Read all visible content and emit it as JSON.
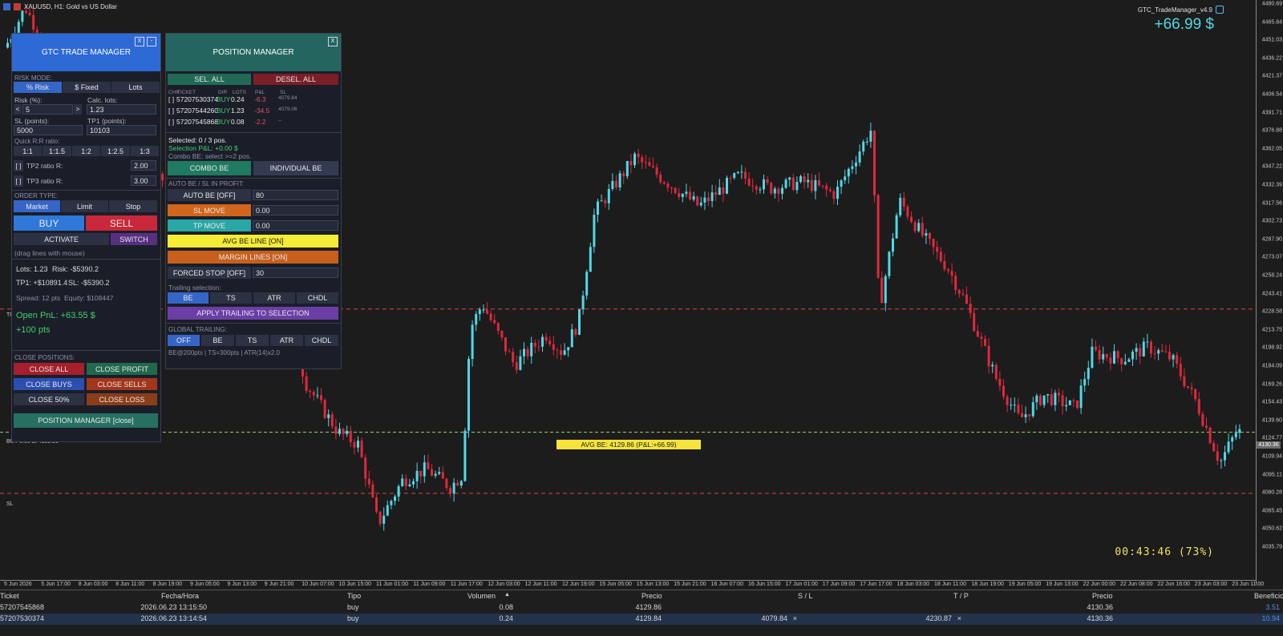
{
  "chart": {
    "symbol_title": "XAUUSD, H1:  Gold vs US Dollar",
    "ea_name": "GTC_TradeManager_v4.9",
    "profit_display": "+66.99 $",
    "timer": "00:43:46  (73%)",
    "avg_be_label": "AVG BE: 4129.86  (P&L:+66.99)",
    "buy_line_label": "BUY 0.08 at 4129.86",
    "sl_label": "SL",
    "tp_label": "TP",
    "current_price_tag": "4130.36",
    "y_ticks": [
      "4480.69",
      "4465.84",
      "4451.03",
      "4436.22",
      "4421.37",
      "4406.54",
      "4391.71",
      "4376.88",
      "4362.05",
      "4347.22",
      "4332.39",
      "4317.56",
      "4302.73",
      "4287.90",
      "4273.07",
      "4258.24",
      "4243.41",
      "4228.58",
      "4213.75",
      "4198.92",
      "4184.09",
      "4169.26",
      "4154.43",
      "4139.60",
      "4124.77",
      "4109.94",
      "4095.11",
      "4080.28",
      "4065.45",
      "4050.62",
      "4035.79"
    ],
    "x_ticks": [
      "5 Jun 2026",
      "5 Jun 17:00",
      "8 Jun 03:00",
      "8 Jun 11:00",
      "8 Jun 19:00",
      "9 Jun 05:00",
      "9 Jun 13:00",
      "9 Jun 21:00",
      "10 Jun 07:00",
      "10 Jun 15:00",
      "11 Jun 01:00",
      "11 Jun 09:00",
      "11 Jun 17:00",
      "12 Jun 03:00",
      "12 Jun 11:00",
      "12 Jun 19:00",
      "15 Jun 05:00",
      "15 Jun 13:00",
      "15 Jun 21:00",
      "16 Jun 07:00",
      "16 Jun 15:00",
      "17 Jun 01:00",
      "17 Jun 09:00",
      "17 Jun 17:00",
      "18 Jun 03:00",
      "18 Jun 11:00",
      "18 Jun 19:00",
      "19 Jun 05:00",
      "19 Jun 13:00",
      "22 Jun 00:00",
      "22 Jun 08:00",
      "22 Jun 16:00",
      "23 Jun 03:00",
      "23 Jun 11:00"
    ],
    "colors": {
      "bull": "#4fd8e8",
      "bear": "#e0283c",
      "avg_be": "#f5e43c",
      "sl_line": "#e04040",
      "tp_line": "#e04040",
      "buy_line": "#9fd36a"
    }
  },
  "gtc": {
    "title": "GTC TRADE MANAGER",
    "btn_x": "X",
    "btn_min": "-",
    "risk_mode_label": "RISK MODE:",
    "risk_modes": [
      "% Risk",
      "$ Fixed",
      "Lots"
    ],
    "risk_pct_label": "Risk (%):",
    "risk_pct_value": "5",
    "risk_dec": "<",
    "risk_inc": ">",
    "calc_lots_label": "Calc. lots:",
    "calc_lots_value": "1.23",
    "sl_points_label": "SL (points):",
    "sl_points_value": "5000",
    "tp1_points_label": "TP1 (points):",
    "tp1_points_value": "10103",
    "quick_rr_label": "Quick R:R ratio:",
    "rr_options": [
      "1:1",
      "1:1.5",
      "1:2",
      "1:2.5",
      "1:3"
    ],
    "tp2_check": "[ ]",
    "tp2_label": "TP2 ratio R:",
    "tp2_value": "2.00",
    "tp3_check": "[ ]",
    "tp3_label": "TP3 ratio R:",
    "tp3_value": "3.00",
    "order_type_label": "ORDER TYPE:",
    "order_types": [
      "Market",
      "Limit",
      "Stop"
    ],
    "buy": "BUY",
    "sell": "SELL",
    "activate": "ACTIVATE",
    "switch": "SWITCH",
    "drag_hint": "(drag lines with mouse)",
    "lots_info": "Lots: 1.23",
    "risk_info": "Risk: -$5390.2",
    "tp1_info": "TP1: +$10891.4",
    "sl_info": "SL: -$5390.2",
    "spread_info": "Spread: 12 pts",
    "equity_info": "Equity: $108447",
    "open_pnl": "Open PnL: +63.55 $",
    "open_pts": "+100 pts",
    "close_label": "CLOSE POSITIONS:",
    "close_all": "CLOSE ALL",
    "close_profit": "CLOSE PROFIT",
    "close_buys": "CLOSE BUYS",
    "close_sells": "CLOSE SELLS",
    "close_50": "CLOSE 50%",
    "close_loss": "CLOSE LOSS",
    "pm_close": "POSITION MANAGER  [close]"
  },
  "pm": {
    "title": "POSITION MANAGER",
    "btn_x": "X",
    "sel_all": "SEL. ALL",
    "desel_all": "DESEL. ALL",
    "headers": [
      "CHK",
      "TICKET",
      "DIR",
      "LOTS",
      "P&L",
      "SL"
    ],
    "rows": [
      {
        "chk": "[ ]",
        "ticket": "57207530374",
        "dir": "BUY",
        "lots": "0.24",
        "pnl": "-6.3",
        "sl": "4079.84"
      },
      {
        "chk": "[ ]",
        "ticket": "57207544260",
        "dir": "BUY",
        "lots": "1.23",
        "pnl": "-34.5",
        "sl": "4079.06"
      },
      {
        "chk": "[ ]",
        "ticket": "57207545868",
        "dir": "BUY",
        "lots": "0.08",
        "pnl": "-2.2",
        "sl": "--"
      }
    ],
    "selected": "Selected: 0 / 3 pos.",
    "selection_pnl": "Selection P&L: +0.00 $",
    "combo_hint": "Combo BE: select >=2 pos.",
    "combo_be": "COMBO BE",
    "individual_be": "INDIVIDUAL BE",
    "auto_be_section": "AUTO BE / SL IN PROFIT:",
    "auto_be": "AUTO BE  [OFF]",
    "auto_be_val": "80",
    "sl_move": "SL MOVE",
    "sl_move_val": "0.00",
    "tp_move": "TP MOVE",
    "tp_move_val": "0.00",
    "avg_be_line": "AVG BE LINE  [ON]",
    "margin_lines": "MARGIN LINES  [ON]",
    "forced_stop": "FORCED STOP [OFF]",
    "forced_stop_val": "30",
    "trailing_label": "Trailing selection:",
    "trailing_opts": [
      "BE",
      "TS",
      "ATR",
      "CHDL"
    ],
    "apply_trailing": "APPLY TRAILING TO SELECTION",
    "global_label": "GLOBAL TRAILING:",
    "global_opts": [
      "OFF",
      "BE",
      "TS",
      "ATR",
      "CHDL"
    ],
    "global_info": "BE@200pts | TS=300pts | ATR(14)x2.0"
  },
  "table": {
    "headers": {
      "ticket": "Ticket",
      "time": "Fecha/Hora",
      "type": "Tipo",
      "volume": "Volumen",
      "sort": "▲",
      "price": "Precio",
      "sl": "S / L",
      "tp": "T / P",
      "cur_price": "Precio",
      "profit": "Beneficio"
    },
    "rows": [
      {
        "ticket": "57207545868",
        "time": "2026.06.23 13:15:50",
        "type": "buy",
        "volume": "0.08",
        "price": "4129.86",
        "sl": "",
        "tp": "",
        "cur_price": "4130.36",
        "profit": "3.51"
      },
      {
        "ticket": "57207530374",
        "time": "2026.06.23 13:14:54",
        "type": "buy",
        "volume": "0.24",
        "price": "4129.84",
        "sl": "4079.84",
        "tp": "4230.87",
        "cur_price": "4130.36",
        "profit": "10.94"
      }
    ],
    "close_x": "×"
  }
}
